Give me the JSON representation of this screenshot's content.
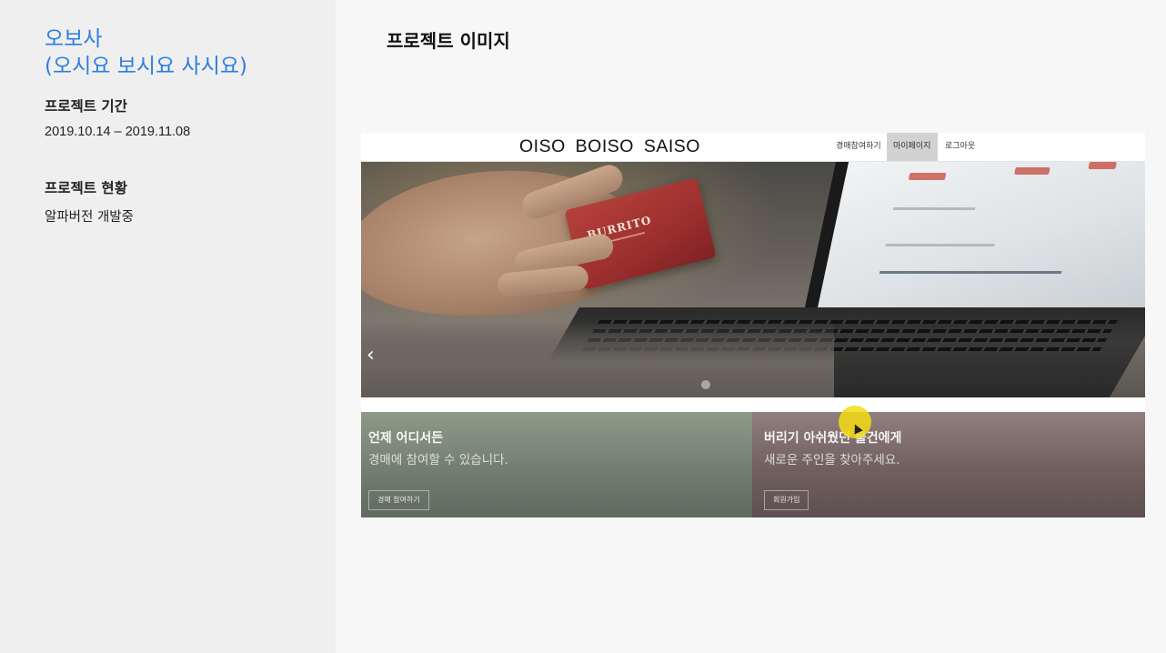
{
  "sidebar": {
    "title_line1": "오보사",
    "title_line2": "(오시요 보시요 사시요)",
    "period_heading": "프로젝트 기간",
    "period_value": "2019.10.14 – 2019.11.08",
    "status_heading": "프로젝트 현황",
    "status_value": "알파버전 개발중"
  },
  "main": {
    "heading": "프로젝트 이미지"
  },
  "screenshot": {
    "logo": "OISO  BOISO  SAISO",
    "nav": [
      "경매참여하기",
      "마이페이지",
      "로그아웃"
    ],
    "active_nav": "마이페이지",
    "card_text": "BURRITO",
    "panels": [
      {
        "title": "언제 어디서든",
        "subtitle": "경매에 참여할 수 있습니다.",
        "button": "경매 참여하기"
      },
      {
        "title": "버리기 아쉬웠던 물건에게",
        "subtitle": "새로운 주인을 찾아주세요.",
        "button": "회원가입"
      }
    ]
  },
  "colors": {
    "accent": "#2f7de1",
    "sidebar_bg": "#efefef",
    "main_bg": "#f7f7f7",
    "cursor_highlight": "#f5dc14"
  }
}
